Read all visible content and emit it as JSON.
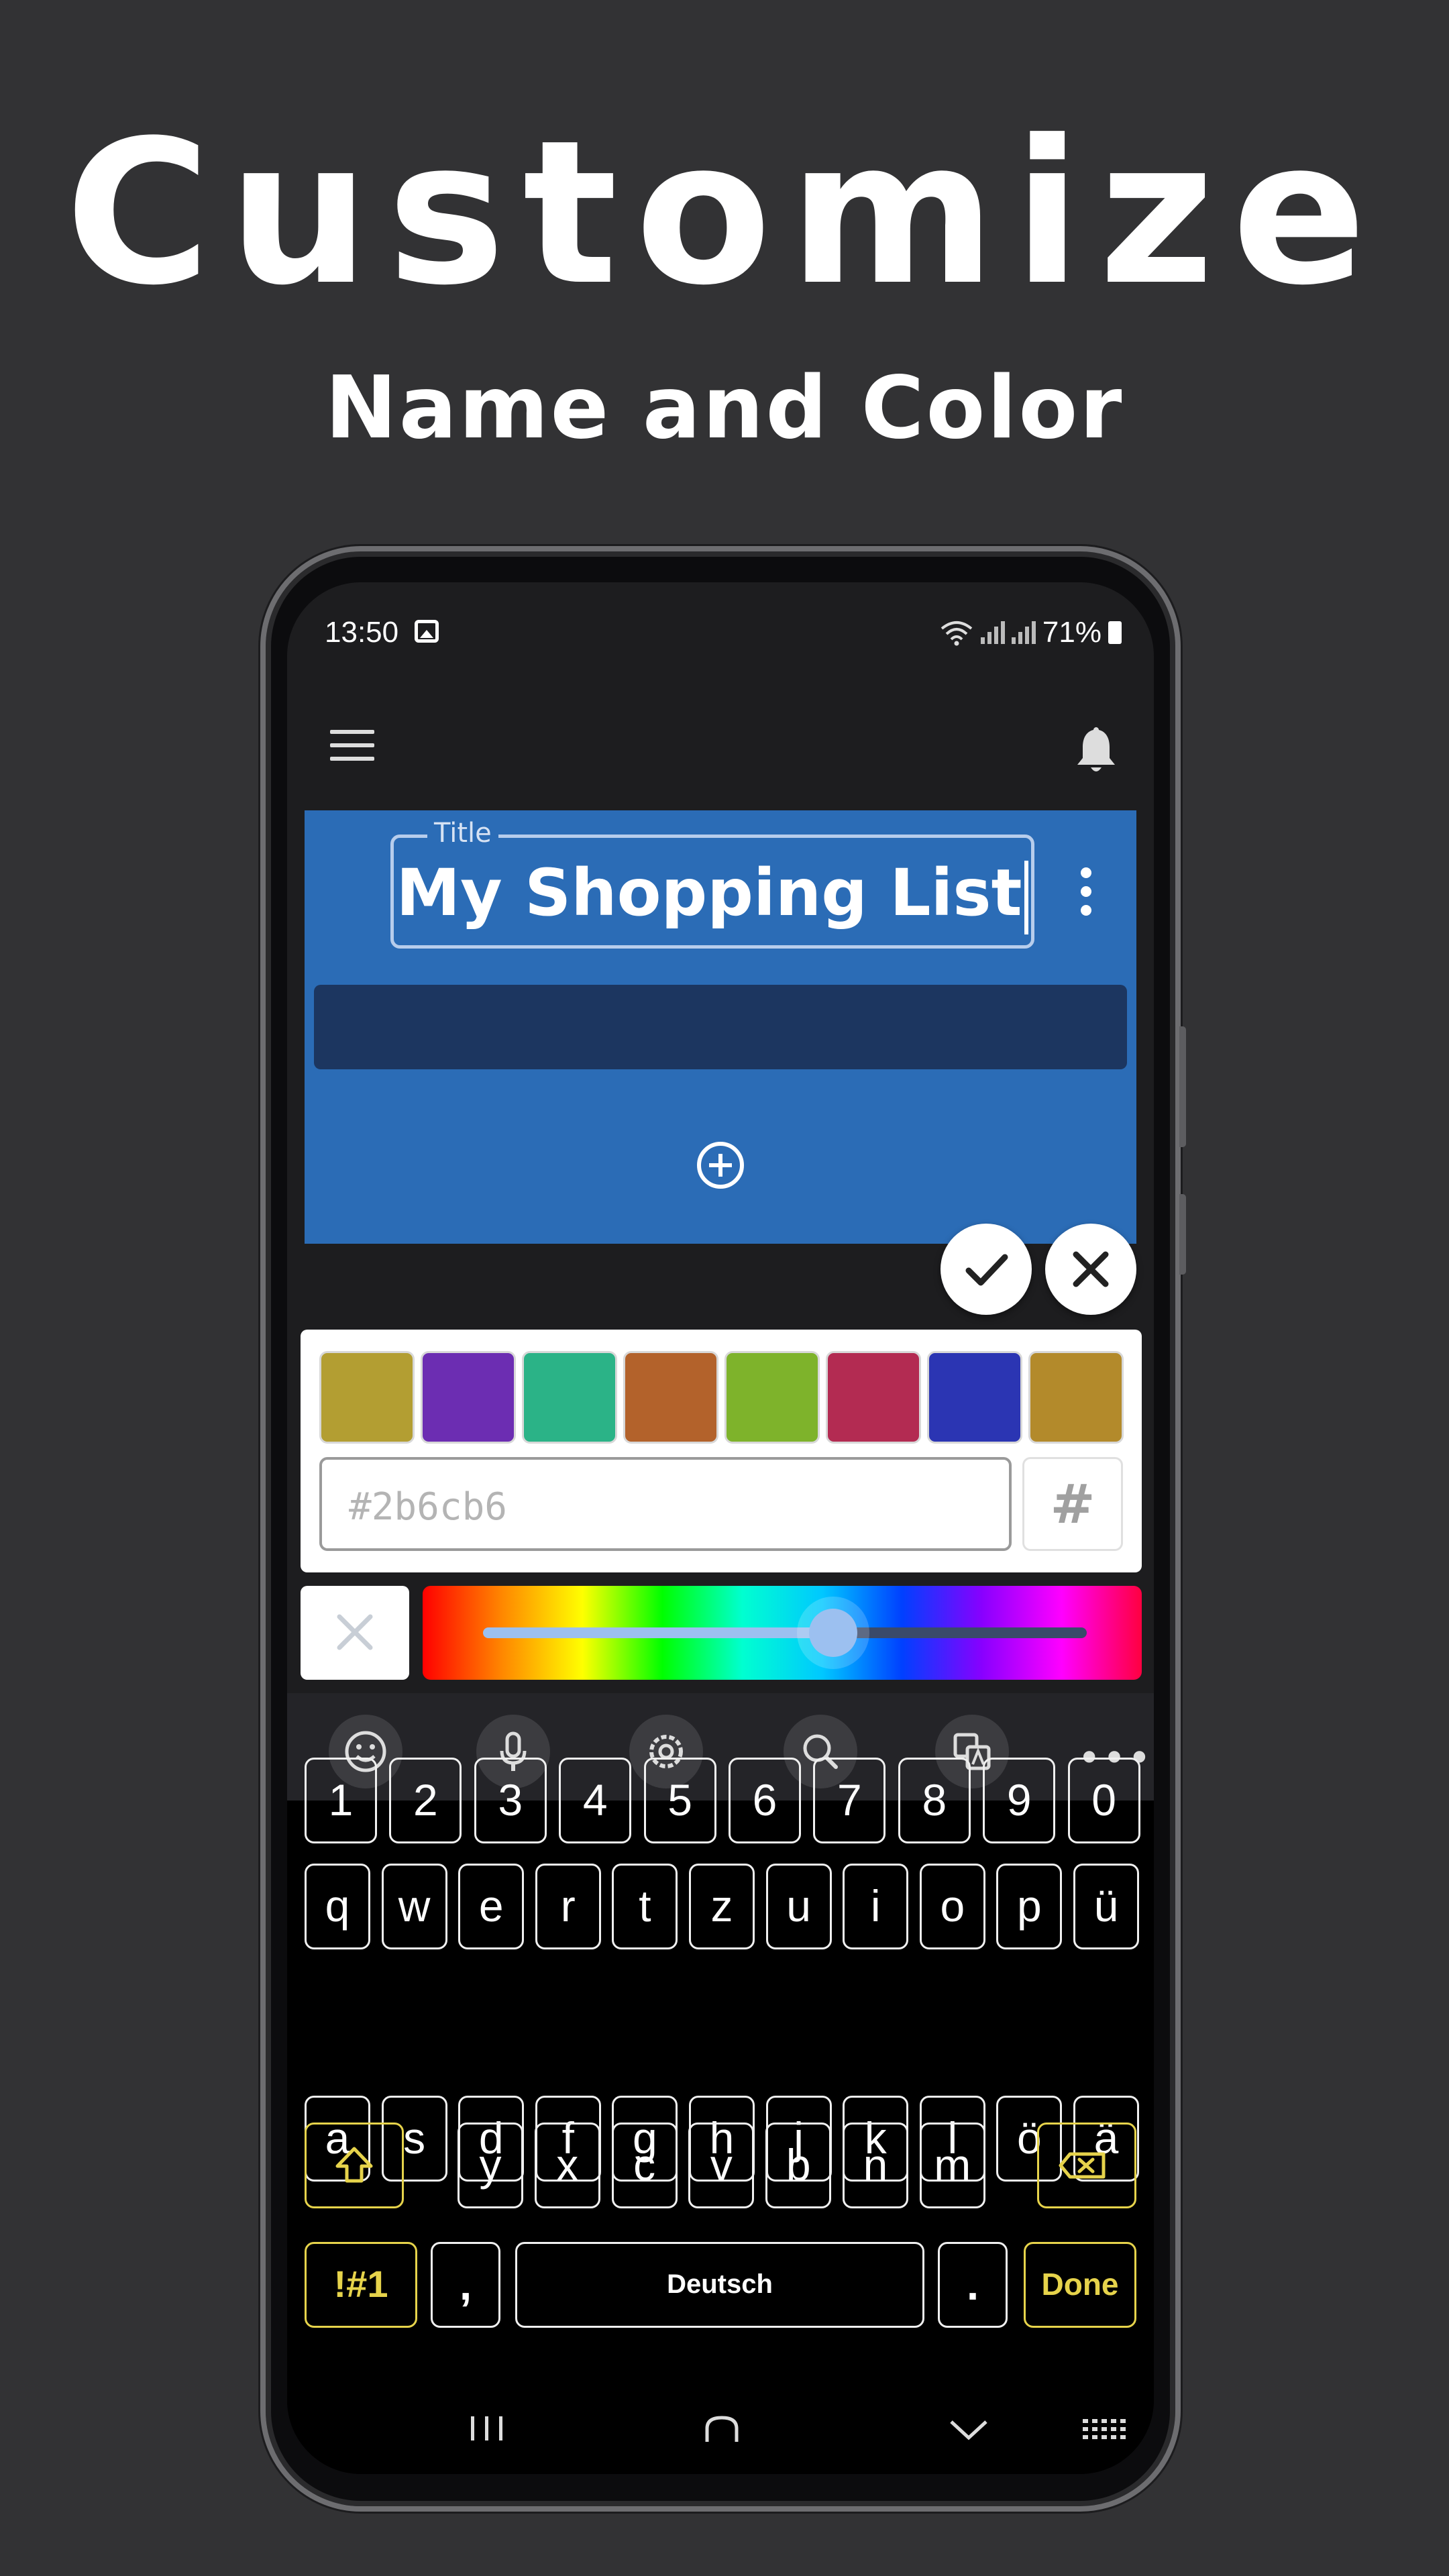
{
  "promo": {
    "headline": "Customize",
    "subline": "Name and Color"
  },
  "status": {
    "time": "13:50",
    "battery": "71%"
  },
  "card": {
    "title_label": "Title",
    "title_value": "My Shopping List",
    "color": "#2b6cb6"
  },
  "palette": {
    "swatches": [
      "#b39e32",
      "#6c2db2",
      "#2bb387",
      "#b3622b",
      "#7eb32b",
      "#b32b52",
      "#2b35b3",
      "#b38a2b"
    ],
    "hex_placeholder": "#2b6cb6",
    "hash_label": "#"
  },
  "hue_slider": {
    "level": 0.58
  },
  "keyboard": {
    "numbers": [
      "1",
      "2",
      "3",
      "4",
      "5",
      "6",
      "7",
      "8",
      "9",
      "0"
    ],
    "row1": [
      "q",
      "w",
      "e",
      "r",
      "t",
      "z",
      "u",
      "i",
      "o",
      "p",
      "ü"
    ],
    "row2": [
      "a",
      "s",
      "d",
      "f",
      "g",
      "h",
      "j",
      "k",
      "l",
      "ö",
      "ä"
    ],
    "row3": [
      "y",
      "x",
      "c",
      "v",
      "b",
      "n",
      "m"
    ],
    "symbols_label": "!#1",
    "comma": ",",
    "space_label": "Deutsch",
    "period": ".",
    "done_label": "Done"
  },
  "icons": [
    "menu-icon",
    "bell-icon",
    "more-vert-icon",
    "add-circle-icon",
    "check-icon",
    "close-icon",
    "emoji-icon",
    "mic-icon",
    "settings-icon",
    "search-icon",
    "translate-icon",
    "shift-icon",
    "backspace-icon"
  ]
}
